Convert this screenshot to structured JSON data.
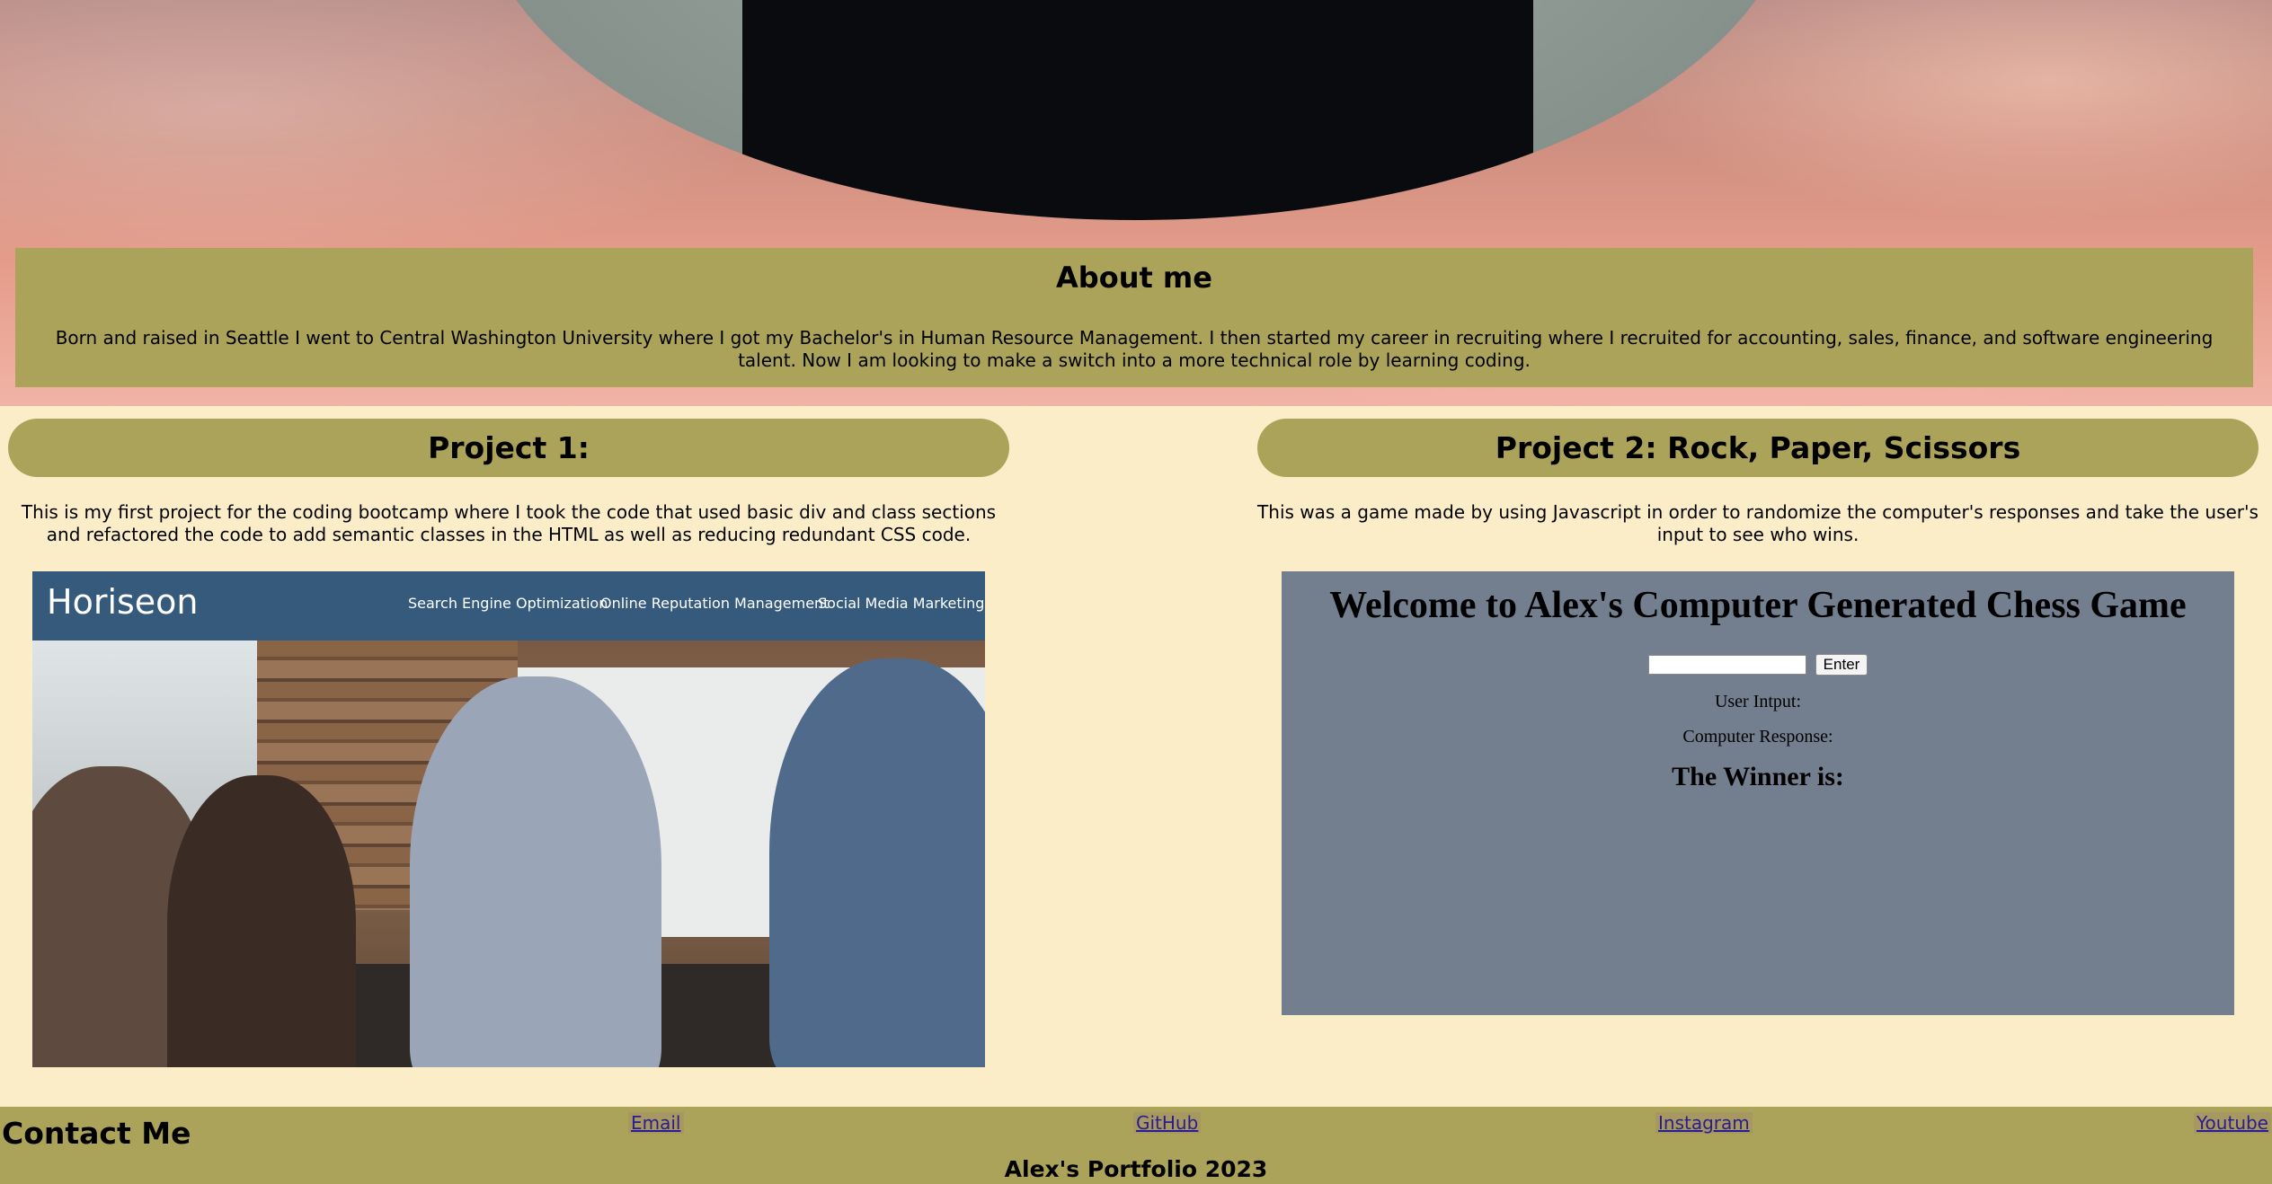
{
  "about": {
    "title": "About me",
    "text": "Born and raised in Seattle I went to Central Washington University where I got my Bachelor's in Human Resource Management. I then started my career in recruiting where I recruited for accounting, sales, finance, and software engineering talent. Now I am looking to make a switch into a more technical role by learning coding."
  },
  "projects": [
    {
      "title": "Project 1:",
      "description": "This is my first project for the coding bootcamp where I took the code that used basic div and class sections and refactored the code to add semantic classes in the HTML as well as reducing redundant CSS code.",
      "preview": {
        "logo": "Horiseon",
        "nav": [
          "Search Engine Optimization",
          "Online Reputation Management",
          "Social Media Marketing"
        ]
      }
    },
    {
      "title": "Project 2: Rock, Paper, Scissors",
      "description": "This was a game made by using Javascript in order to randomize the computer's responses and take the user's input to see who wins.",
      "preview": {
        "heading": "Welcome to Alex's Computer Generated Chess Game",
        "input_value": "",
        "button_label": "Enter",
        "user_input_label": "User Intput:",
        "computer_response_label": "Computer Response:",
        "winner_label": "The Winner is:"
      }
    }
  ],
  "footer": {
    "contact_title": "Contact Me",
    "links": [
      "Email",
      "GitHub",
      "Instagram",
      "Youtube"
    ],
    "copyright": "Alex's Portfolio 2023"
  },
  "colors": {
    "page_background": "#faedc8",
    "panel": "#aca35b",
    "game_panel": "#737e8f",
    "horiseon_bar": "#365a7b",
    "link": "#2a1d8f"
  }
}
